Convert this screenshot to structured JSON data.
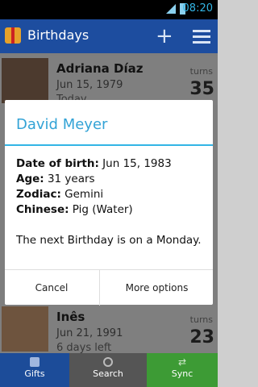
{
  "status": {
    "time": "08:20"
  },
  "actionbar": {
    "title": "Birthdays"
  },
  "list": [
    {
      "name": "Adriana Díaz",
      "date": "Jun 15, 1979",
      "sub": "Today",
      "turns": "turns",
      "age": "35"
    },
    {
      "name": "Inês",
      "date": "Jun 21, 1991",
      "sub": "6 days left",
      "turns": "turns",
      "age": "23"
    }
  ],
  "dialog": {
    "title": "David Meyer",
    "dob_label": "Date of birth:",
    "dob_value": " Jun 15, 1983",
    "age_label": "Age:",
    "age_value": " 31 years",
    "zodiac_label": "Zodiac:",
    "zodiac_value": " Gemini",
    "chinese_label": "Chinese:",
    "chinese_value": " Pig (Water)",
    "note": "The next Birthday is on a Monday.",
    "cancel": "Cancel",
    "more": "More options"
  },
  "tabs": {
    "gifts": "Gifts",
    "search": "Search",
    "sync": "Sync"
  }
}
